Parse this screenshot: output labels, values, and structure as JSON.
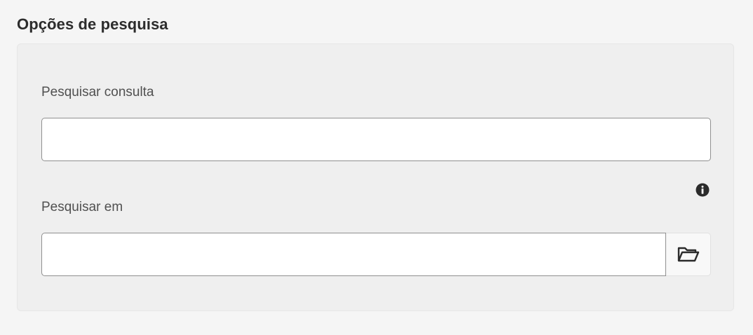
{
  "section": {
    "title": "Opções de pesquisa"
  },
  "fields": {
    "query": {
      "label": "Pesquisar consulta",
      "value": "",
      "placeholder": ""
    },
    "search_in": {
      "label": "Pesquisar em",
      "value": "",
      "placeholder": ""
    }
  },
  "icons": {
    "info": "info-icon",
    "browse": "folder-icon"
  },
  "colors": {
    "background": "#f5f5f5",
    "panel": "#efefef",
    "input_border": "#8f8f8f",
    "text": "#2c2c2c",
    "label": "#505050"
  }
}
